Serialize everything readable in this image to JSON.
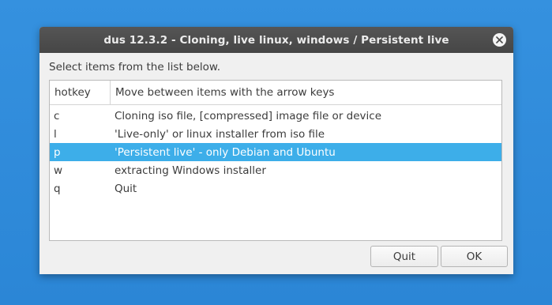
{
  "window": {
    "title": "dus 12.3.2 - Cloning, live linux, windows / Persistent live"
  },
  "prompt": "Select items from the list below.",
  "list": {
    "columns": [
      "hotkey",
      "Move between items with the arrow keys"
    ],
    "rows": [
      {
        "key": "c",
        "description": "Cloning iso file, [compressed] image file or device",
        "selected": false
      },
      {
        "key": "l",
        "description": "'Live-only' or linux installer from iso file",
        "selected": false
      },
      {
        "key": "p",
        "description": "'Persistent live' - only Debian and Ubuntu",
        "selected": true
      },
      {
        "key": "w",
        "description": "extracting Windows installer",
        "selected": false
      },
      {
        "key": "q",
        "description": "Quit",
        "selected": false
      }
    ]
  },
  "buttons": {
    "quit": "Quit",
    "ok": "OK"
  },
  "colors": {
    "desktop": "#2f8ad8",
    "titlebar": "#4a4a4a",
    "selection": "#3daee9"
  },
  "icons": {
    "close": "close-icon"
  }
}
